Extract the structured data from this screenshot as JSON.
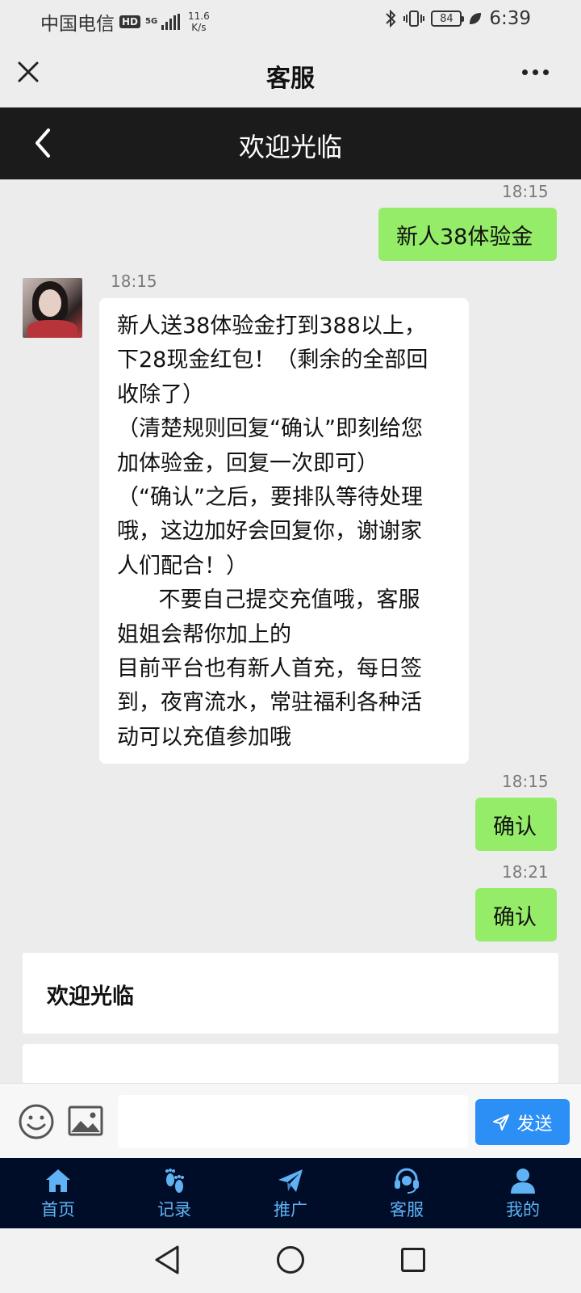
{
  "status_bar": {
    "carrier": "中国电信",
    "hd": "HD",
    "network": "5G",
    "speed_value": "11.6",
    "speed_unit": "K/s",
    "battery": "84",
    "time": "6:39"
  },
  "header": {
    "title": "客服",
    "close_icon": "close-icon",
    "more_icon": "more-icon"
  },
  "chat_topbar": {
    "title": "欢迎光临",
    "back_icon": "back-icon"
  },
  "messages": [
    {
      "direction": "out",
      "time": "18:15",
      "text": "新人38体验金"
    },
    {
      "direction": "in",
      "time": "18:15",
      "lines": [
        "新人送38体验金打到388以上，",
        "下28现金红包！（剩余的全部回",
        "收除了）",
        "（清楚规则回复“确认”即刻给您",
        "加体验金，回复一次即可）",
        "（“确认”之后，要排队等待处理",
        "哦，这边加好会回复你，谢谢家",
        "人们配合！）",
        "      不要自己提交充值哦，客服",
        "姐姐会帮你加上的",
        "目前平台也有新人首充，每日签",
        "到，夜宵流水，常驻福利各种活",
        "动可以充值参加哦"
      ]
    },
    {
      "direction": "out",
      "time": "18:15",
      "text": "确认"
    },
    {
      "direction": "out",
      "time": "18:21",
      "text": "确认"
    }
  ],
  "welcome_card": {
    "title": "欢迎光临"
  },
  "input_bar": {
    "placeholder": "",
    "value": "",
    "send_label": "发送"
  },
  "bottom_nav": [
    {
      "label": "首页",
      "icon": "home-icon"
    },
    {
      "label": "记录",
      "icon": "footprint-icon"
    },
    {
      "label": "推广",
      "icon": "paper-plane-icon"
    },
    {
      "label": "客服",
      "icon": "headset-icon"
    },
    {
      "label": "我的",
      "icon": "person-icon"
    }
  ],
  "colors": {
    "outgoing_bubble": "#95ec69",
    "send_button": "#2b8ff5",
    "nav_background": "#000d28",
    "nav_accent": "#5fb2f4"
  }
}
